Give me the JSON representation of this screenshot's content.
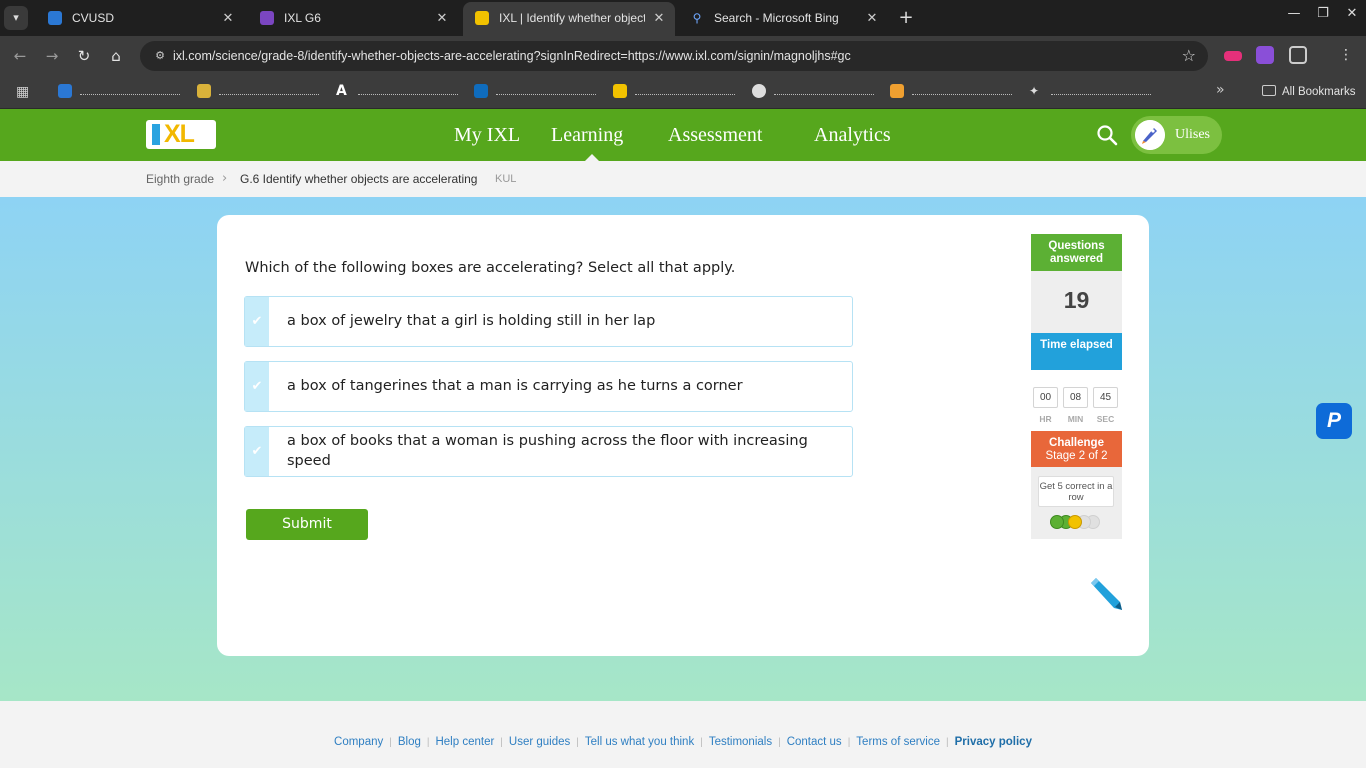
{
  "browser": {
    "tabs": [
      {
        "label": "CVUSD",
        "favicon_color": "#2b78d4",
        "active": false
      },
      {
        "label": "IXL G6",
        "favicon_color": "#7b46c1",
        "active": false
      },
      {
        "label": "IXL | Identify whether objects a",
        "favicon_color": "#f2c200",
        "active": true
      },
      {
        "label": "Search - Microsoft Bing",
        "favicon_color": "#2b78d4",
        "active": false
      }
    ],
    "tab_close_glyph": "✕",
    "new_tab_glyph": "+",
    "window_controls": [
      "—",
      "❐",
      "✕"
    ],
    "url": "ixl.com/science/grade-8/identify-whether-objects-are-accelerating?signInRedirect=https://www.ixl.com/signin/magnoljhs#gc",
    "bookmarks_more": "»",
    "all_bookmarks": "All Bookmarks"
  },
  "ixl": {
    "logo_text": "XL",
    "nav": [
      "My IXL",
      "Learning",
      "Assessment",
      "Analytics"
    ],
    "active_nav": "Learning",
    "user_name": "Ulises"
  },
  "breadcrumb": {
    "grade": "Eighth grade",
    "separator": "›",
    "skill": "G.6 Identify whether objects are accelerating",
    "code": "KUL"
  },
  "question": {
    "prompt": "Which of the following boxes are accelerating? Select all that apply.",
    "check_glyph": "✔",
    "choices": [
      "a box of jewelry that a girl is holding still in her lap",
      "a box of tangerines that a man is carrying as he turns a corner",
      "a box of books that a woman is pushing across the floor with increasing speed"
    ],
    "submit_label": "Submit"
  },
  "sidebar": {
    "questions_label": "Questions answered",
    "questions_count": "19",
    "time_label": "Time elapsed",
    "time": {
      "hr": "00",
      "min": "08",
      "sec": "45"
    },
    "time_units": {
      "hr": "HR",
      "min": "MIN",
      "sec": "SEC"
    },
    "challenge_label": "Challenge",
    "challenge_stage": "Stage 2 of 2",
    "challenge_goal": "Get 5 correct in a row",
    "streak_correct": 3,
    "streak_total": 5,
    "colors": {
      "green": "#5cb034",
      "blue": "#22a1db",
      "orange": "#e8673a"
    }
  },
  "colors": {
    "brand_green": "#56a71d",
    "link_blue": "#2f7fc2"
  },
  "floating_badge": "P",
  "footer": {
    "links": [
      "Company",
      "Blog",
      "Help center",
      "User guides",
      "Tell us what you think",
      "Testimonials",
      "Contact us",
      "Terms of service"
    ],
    "privacy": "Privacy policy"
  }
}
